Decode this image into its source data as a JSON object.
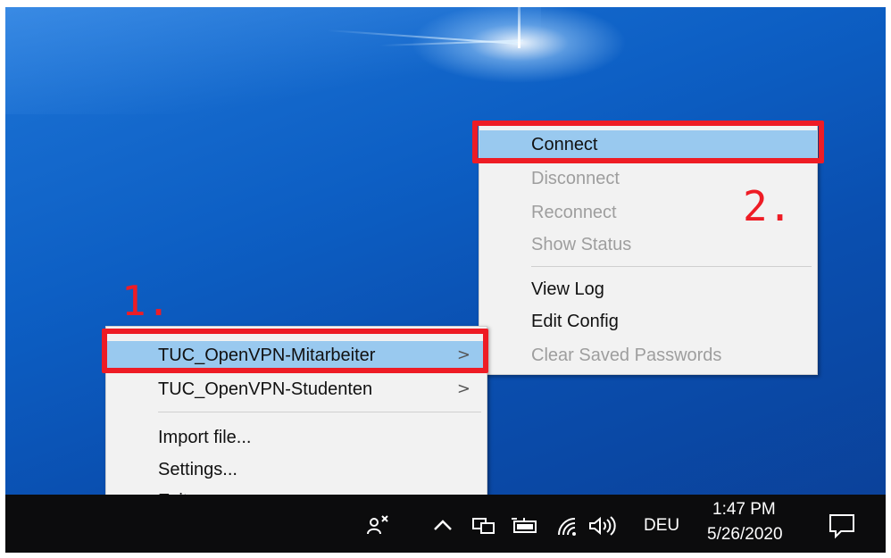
{
  "main_menu": {
    "items": [
      {
        "label": "TUC_OpenVPN-Mitarbeiter",
        "has_submenu": true,
        "highlighted": true
      },
      {
        "label": "TUC_OpenVPN-Studenten",
        "has_submenu": true,
        "highlighted": false
      }
    ],
    "actions": [
      {
        "label": "Import file..."
      },
      {
        "label": "Settings..."
      },
      {
        "label": "Exit"
      }
    ],
    "submenu_arrow": ">"
  },
  "sub_menu": {
    "items": [
      {
        "label": "Connect",
        "enabled": true,
        "highlighted": true
      },
      {
        "label": "Disconnect",
        "enabled": false
      },
      {
        "label": "Reconnect",
        "enabled": false
      },
      {
        "label": "Show Status",
        "enabled": false
      }
    ],
    "items2": [
      {
        "label": "View Log",
        "enabled": true
      },
      {
        "label": "Edit Config",
        "enabled": true
      },
      {
        "label": "Clear Saved Passwords",
        "enabled": false
      }
    ]
  },
  "annotations": {
    "step1": "1.",
    "step2": "2.",
    "callout_color": "#ee1c25"
  },
  "taskbar": {
    "tray_icons": [
      "openvpn-icon",
      "chevron-up-icon",
      "network-icon",
      "battery-icon",
      "wifi-icon",
      "volume-icon"
    ],
    "language": "DEU",
    "time": "1:47 PM",
    "date": "5/26/2020",
    "notification_icon": "action-center-icon"
  },
  "colors": {
    "menu_highlight": "#99c9ef",
    "disabled_text": "#9e9e9e",
    "taskbar": "#0c0c0d"
  }
}
